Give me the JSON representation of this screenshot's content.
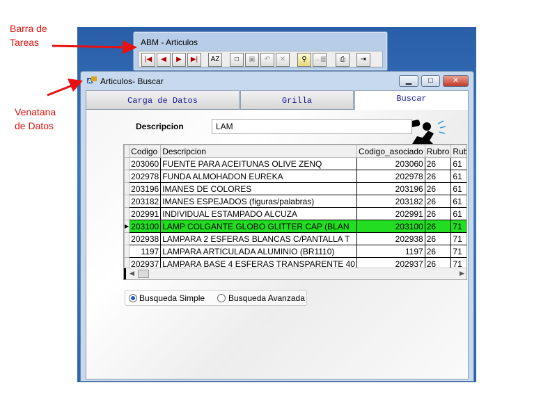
{
  "annotations": {
    "taskbar": [
      "Barra de",
      "Tareas"
    ],
    "window": [
      "Venatana",
      "de Datos"
    ]
  },
  "toolbar_window": {
    "title": "ABM - Articulos",
    "buttons": [
      {
        "name": "first-record-icon",
        "glyph": "|◀"
      },
      {
        "name": "prev-record-icon",
        "glyph": "◀"
      },
      {
        "name": "next-record-icon",
        "glyph": "▶"
      },
      {
        "name": "last-record-icon",
        "glyph": "▶|"
      },
      {
        "name": "sort-az-icon",
        "glyph": "AZ"
      },
      {
        "name": "new-document-icon",
        "glyph": "□"
      },
      {
        "name": "save-icon",
        "glyph": "▣"
      },
      {
        "name": "undo-icon",
        "glyph": "↶"
      },
      {
        "name": "delete-icon",
        "glyph": "✕"
      },
      {
        "name": "search-icon",
        "glyph": "⚲"
      },
      {
        "name": "export-icon",
        "glyph": "→▦"
      },
      {
        "name": "print-icon",
        "glyph": "⎙"
      },
      {
        "name": "exit-door-icon",
        "glyph": "⇥"
      }
    ]
  },
  "main_window": {
    "title": "Articulos- Buscar",
    "controls": {
      "minimize": "▁",
      "maximize": "□",
      "close": "✕"
    },
    "tabs": [
      "Carga de Datos",
      "Grilla",
      "Buscar"
    ],
    "active_tab": "Buscar"
  },
  "search": {
    "label": "Descripcion",
    "value": "LAM"
  },
  "grid": {
    "columns": [
      "Codigo",
      "Descripcion",
      "Codigo_asociado",
      "Rubro",
      "Rub"
    ],
    "rows": [
      [
        "203060",
        "FUENTE PARA ACEITUNAS OLIVE ZENQ",
        "203060",
        "26",
        "61"
      ],
      [
        "202978",
        "FUNDA ALMOHADON EUREKA",
        "202978",
        "26",
        "61"
      ],
      [
        "203196",
        "IMANES DE COLORES",
        "203196",
        "26",
        "61"
      ],
      [
        "203182",
        "IMANES ESPEJADOS  (figuras/palabras)",
        "203182",
        "26",
        "61"
      ],
      [
        "202991",
        "INDIVIDUAL ESTAMPADO ALCUZA",
        "202991",
        "26",
        "61"
      ],
      [
        "203100",
        "LAMP COLGANTE GLOBO GLITTER CAP (BLAN",
        "203100",
        "26",
        "71"
      ],
      [
        "202938",
        "LAMPARA  2 ESFERAS BLANCAS C/PANTALLA T",
        "202938",
        "26",
        "71"
      ],
      [
        "1197",
        "LAMPARA ARTICULADA  ALUMINIO (BR1110)",
        "1197",
        "26",
        "71"
      ],
      [
        "202937",
        "LAMPARA BASE 4 ESFERAS TRANSPARENTE 40",
        "202937",
        "26",
        "71"
      ]
    ],
    "selected_row": 5,
    "selected_color": "#22dd22"
  },
  "search_mode": {
    "options": [
      "Busqueda Simple",
      "Busqueda Avanzada"
    ],
    "selected": "Busqueda Simple"
  }
}
